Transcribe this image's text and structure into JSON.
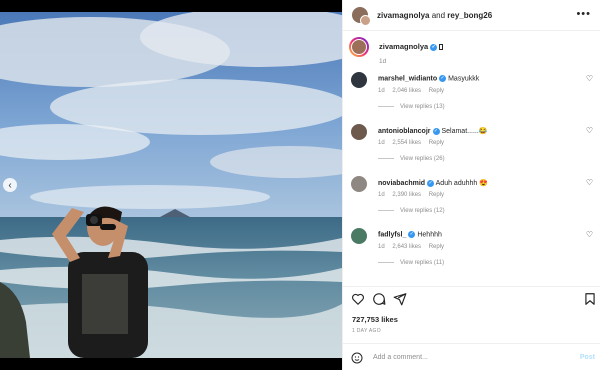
{
  "header": {
    "user1": "zivamagnolya",
    "and": "and",
    "user2": "rey_bong26"
  },
  "caption": {
    "username": "zivamagnolya",
    "time": "1d"
  },
  "comments": [
    {
      "username": "marshel_widianto",
      "text": "Masyukkk",
      "time": "1d",
      "likes": "2,046 likes",
      "reply": "Reply",
      "view_replies": "View replies (13)",
      "avatar_color": "#2f3640"
    },
    {
      "username": "antonioblancojr",
      "text": "Selamat......😂",
      "time": "1d",
      "likes": "2,554 likes",
      "reply": "Reply",
      "view_replies": "View replies (26)",
      "avatar_color": "#6d5a4c"
    },
    {
      "username": "noviabachmid",
      "text": "Aduh aduhhh 😍",
      "time": "1d",
      "likes": "2,390 likes",
      "reply": "Reply",
      "view_replies": "View replies (12)",
      "avatar_color": "#8f8782"
    },
    {
      "username": "fadlyfsl_",
      "text": "Hehhhh",
      "time": "1d",
      "likes": "2,643 likes",
      "reply": "Reply",
      "view_replies": "View replies (11)",
      "avatar_color": "#4b7a64"
    }
  ],
  "post": {
    "likes": "727,753 likes",
    "ago": "1 DAY AGO"
  },
  "add_comment": {
    "placeholder": "Add a comment...",
    "post_label": "Post"
  },
  "icons": {
    "more": "more-options-icon",
    "heart": "heart-icon",
    "comment": "comment-icon",
    "share": "share-icon",
    "save": "bookmark-icon",
    "emoji": "emoji-icon",
    "prev": "chevron-left-icon"
  },
  "colors": {
    "verified": "#3897f0",
    "post_button": "#b2dffc"
  }
}
